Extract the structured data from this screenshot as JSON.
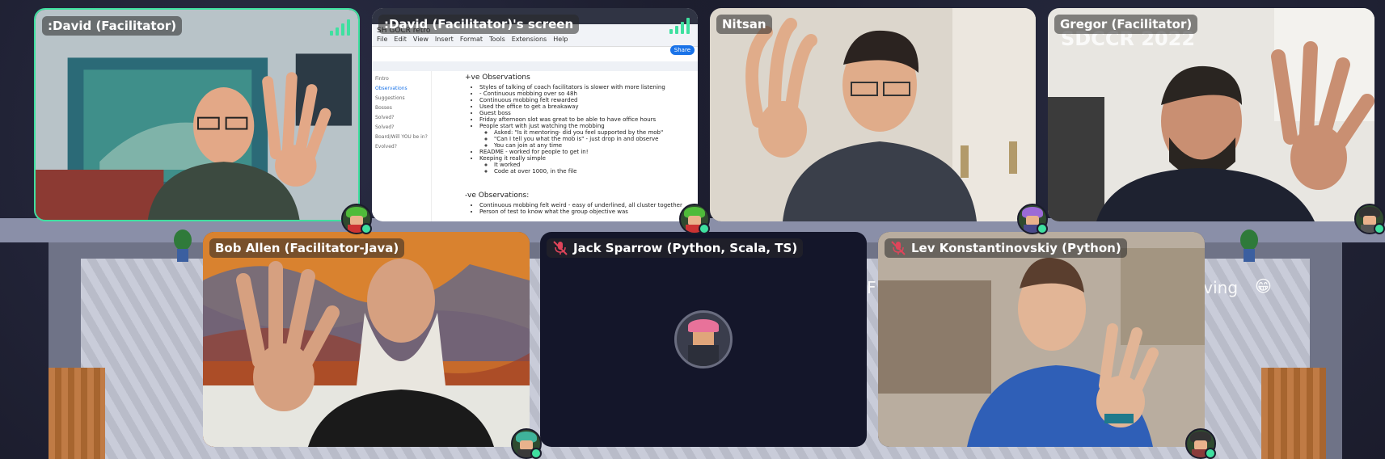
{
  "tiles": {
    "david": {
      "name": ":David (Facilitator)"
    },
    "screen": {
      "name": ":David (Facilitator)'s screen",
      "doc_title": "SH GOCR retro",
      "menu": [
        "File",
        "Edit",
        "View",
        "Insert",
        "Format",
        "Tools",
        "Extensions",
        "Help"
      ],
      "share_label": "Share",
      "sidebar": [
        "Fintro",
        "",
        "Observations",
        "",
        "Suggestions",
        "Bosses",
        "Solved?",
        "Solved?",
        "Board/Will YOU be in?",
        "Evolved?"
      ],
      "heading_pos": "+ve Observations",
      "pos_items": [
        "Styles of talking of coach facilitators is slower with more listening",
        "- Continuous mobbing over so 48h",
        "Continuous mobbing felt rewarded",
        "Used the office to get a breakaway",
        "Guest boss",
        "Friday afternoon slot was great to be able to have office hours",
        "People start with just watching the mobbing"
      ],
      "pos_sub_items": [
        "Asked: \"Is it mentoring- did you feel supported by the mob\"",
        "\"Can I tell you what the mob is\" - just drop in and observe",
        "You can join at any time"
      ],
      "pos_items2": [
        "README - worked for people to get in!",
        "Keeping it really simple"
      ],
      "pos_sub_items2": [
        "It worked",
        "Code at over 1000, in the file"
      ],
      "heading_neg": "-ve Observations:",
      "neg_items": [
        "Continuous mobbing felt weird - easy of underlined, all cluster together",
        "Person of test to know what the group objective was"
      ]
    },
    "nitsan": {
      "name": "Nitsan"
    },
    "gregor": {
      "name": "Gregor (Facilitator)",
      "shirt_text": "SDCCR 2022"
    },
    "bob": {
      "name": "Bob Allen (Facilitator-Java)"
    },
    "jack": {
      "name": "Jack Sparrow (Python, Scala, TS)"
    },
    "lev": {
      "name": "Lev Konstantinovskiy (Python)"
    }
  },
  "background_text": {
    "left": "F",
    "right": "aving",
    "emoji": "😁"
  },
  "colors": {
    "accent": "#3fe0a0",
    "background": "#1b1c2c",
    "tile_dark": "#14162a"
  }
}
